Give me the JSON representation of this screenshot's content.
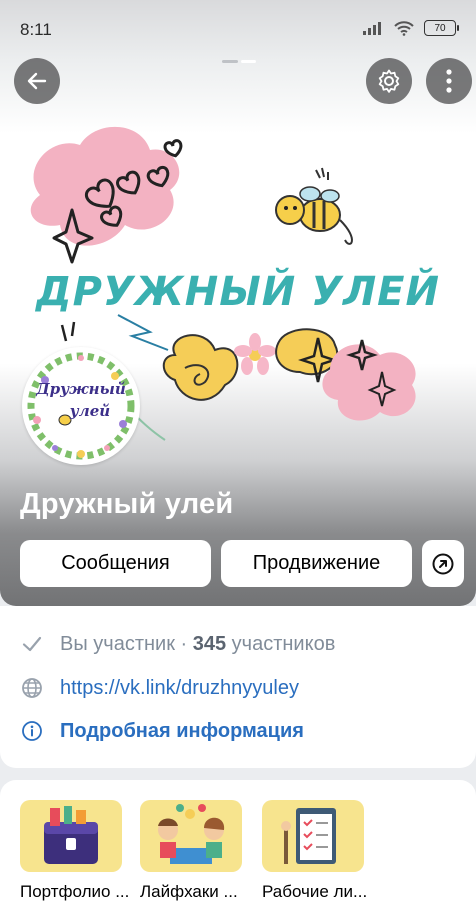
{
  "status_bar": {
    "time": "8:11",
    "battery": "70"
  },
  "cover": {
    "title_art_text": "ДРУЖНЫЙ УЛЕЙ"
  },
  "avatar": {
    "line1": "Дружный",
    "line2": "улей"
  },
  "group": {
    "name": "Дружный улей"
  },
  "actions": {
    "messages": "Сообщения",
    "promotion": "Продвижение"
  },
  "info": {
    "member_status": "Вы участник ·",
    "member_count": "345",
    "member_suffix": "участников",
    "link": "https://vk.link/druzhnyyuley",
    "details": "Подробная информация"
  },
  "albums": [
    {
      "label": "Портфолио ..."
    },
    {
      "label": "Лайфхаки ..."
    },
    {
      "label": "Рабочие ли..."
    }
  ],
  "colors": {
    "accent_link": "#2a6ebf",
    "cover_teal": "#3ab0b0",
    "pink": "#f3aec0",
    "yellow": "#f5cd57"
  },
  "icons": [
    "back-arrow-icon",
    "gear-icon",
    "more-vertical-icon",
    "share-arrow-icon",
    "checkmark-icon",
    "globe-icon",
    "info-icon"
  ]
}
